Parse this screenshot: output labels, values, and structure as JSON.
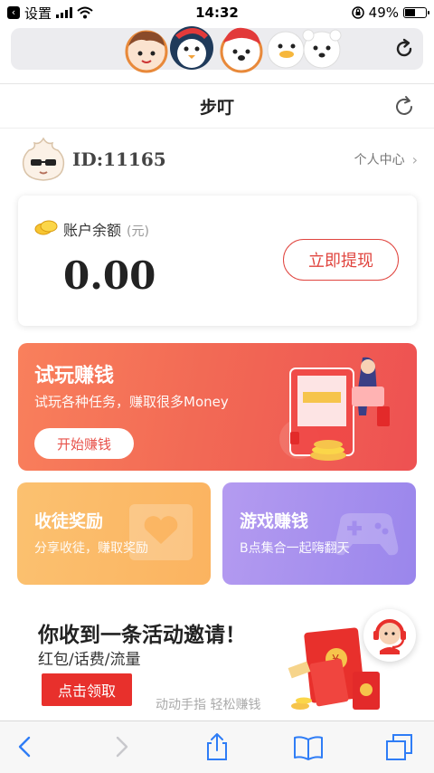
{
  "status_bar": {
    "back_app": "设置",
    "time": "14:32",
    "battery_percent_text": "49%",
    "battery_level": 0.49
  },
  "page": {
    "title": "步叮"
  },
  "user": {
    "id_text": "ID:11165",
    "profile_link": "个人中心"
  },
  "balance": {
    "label": "账户余额",
    "unit": "(元)",
    "amount": "0.00",
    "withdraw_button": "立即提现"
  },
  "trial_card": {
    "title": "试玩赚钱",
    "subtitle": "试玩各种任务，赚取很多Money",
    "button": "开始赚钱"
  },
  "invite_card": {
    "title": "收徒奖励",
    "subtitle": "分享收徒，赚取奖励"
  },
  "game_card": {
    "title": "游戏赚钱",
    "subtitle": "B点集合一起嗨翻天"
  },
  "promo": {
    "title": "你收到一条活动邀请！",
    "subtitle": "红包/话费/流量",
    "button": "点击领取",
    "slogan": "动动手指 轻松赚钱"
  },
  "colors": {
    "accent_red": "#e0453f",
    "trial_gradient_start": "#f9805c",
    "invite_orange": "#fbb360",
    "game_purple": "#a38ff0"
  },
  "icons": {
    "url_reload": "reload-icon",
    "page_refresh": "refresh-icon",
    "toolbar": [
      "back-arrow-icon",
      "forward-arrow-icon",
      "share-icon",
      "bookmarks-icon",
      "tabs-icon"
    ]
  }
}
